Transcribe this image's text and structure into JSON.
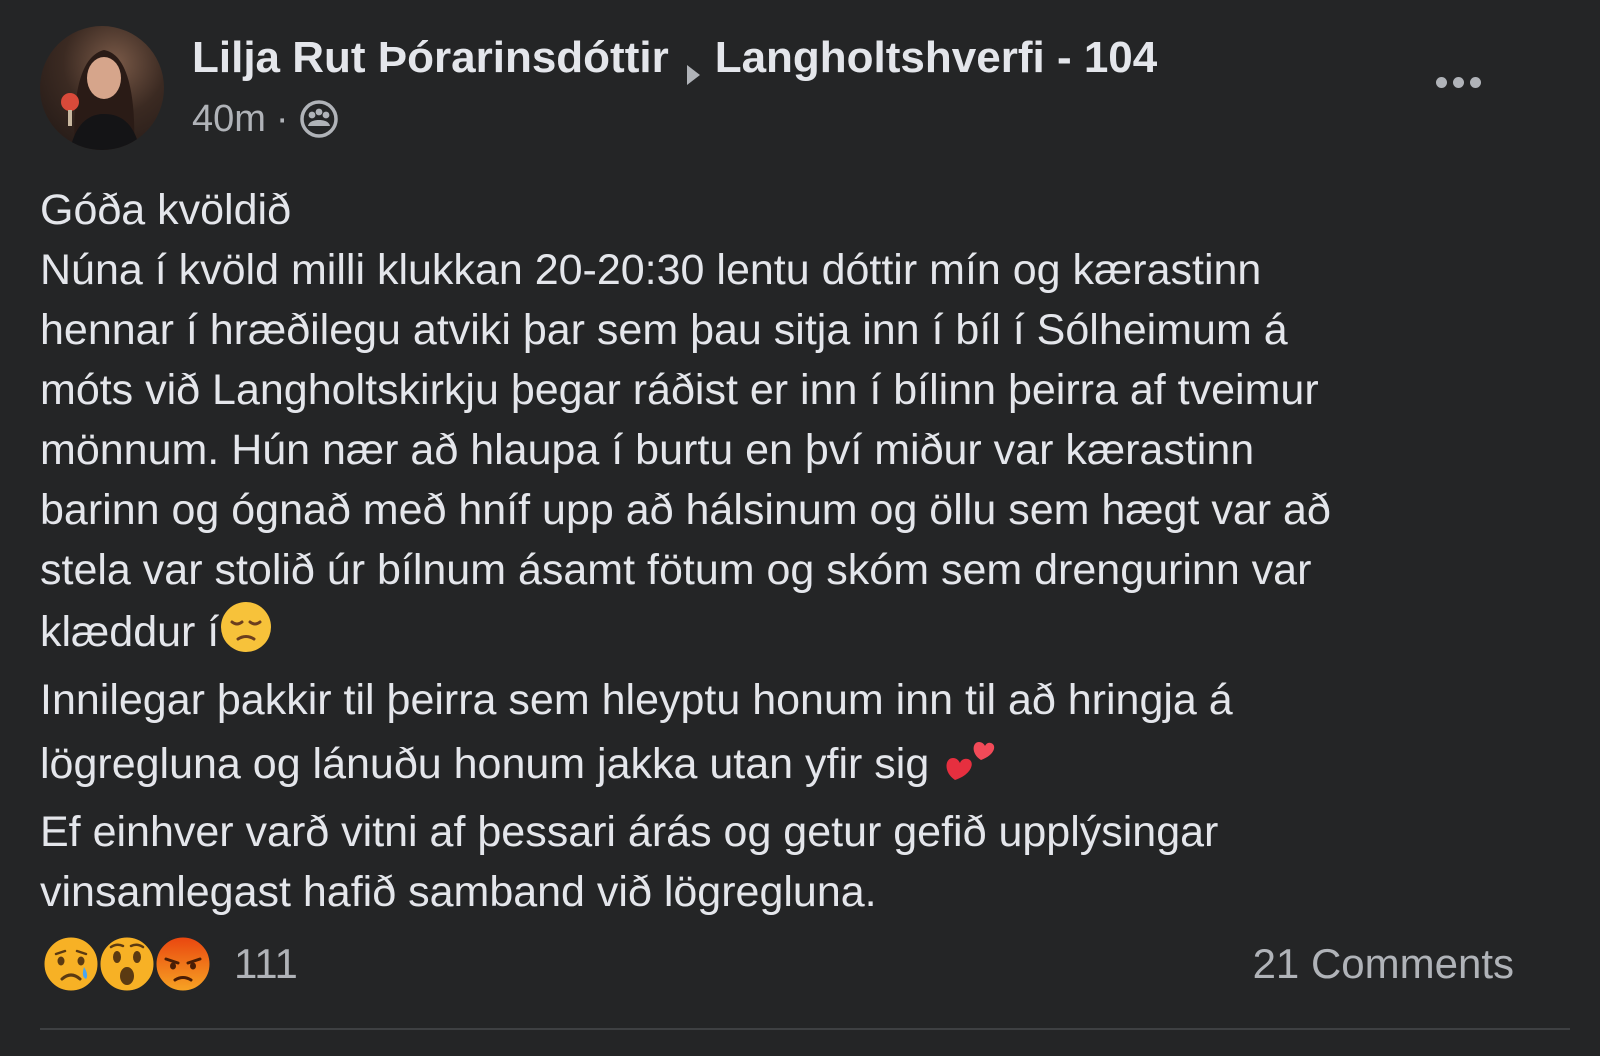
{
  "post": {
    "author": "Lilja Rut Þórarinsdóttir",
    "group": "Langholtshverfi - 104",
    "time": "40m",
    "separator": "·",
    "audience_icon": "group-audience-icon",
    "avatar_icon": "profile-photo",
    "more_icon": "more-options-icon",
    "lines": [
      "Góða kvöldið",
      "Núna í kvöld milli klukkan 20-20:30 lentu dóttir mín og kærastinn",
      "hennar í hræðilegu atviki þar sem þau sitja inn í bíl í Sólheimum á",
      "móts við Langholtskirkju þegar ráðist er inn í bílinn þeirra af tveimur",
      "mönnum.  Hún nær að hlaupa í burtu en því miður var kærastinn",
      "barinn og ógnað með hníf upp að hálsinum og öllu sem hægt var að",
      "stela var stolið úr bílnum ásamt fötum og skóm sem drengurinn var",
      "klæddur í",
      "Innilegar þakkir til þeirra sem hleyptu honum inn til að hringja á",
      "lögregluna og lánuðu honum jakka utan yfir sig ",
      "Ef einhver varð vitni af þessari árás og getur gefið upplýsingar",
      "vinsamlegast hafið samband við lögregluna."
    ],
    "inline_emojis": [
      "pensive-face-emoji",
      "two-hearts-emoji"
    ]
  },
  "reactions": {
    "icons": [
      "sad-reaction-icon",
      "wow-reaction-icon",
      "angry-reaction-icon"
    ],
    "count": "111"
  },
  "comments": {
    "label": "21 Comments"
  },
  "colors": {
    "background": "#242526",
    "primary_text": "#e4e6eb",
    "secondary_text": "#b0b3b8",
    "reaction_yellow": "#f7b125",
    "angry_red": "#e9710f"
  }
}
